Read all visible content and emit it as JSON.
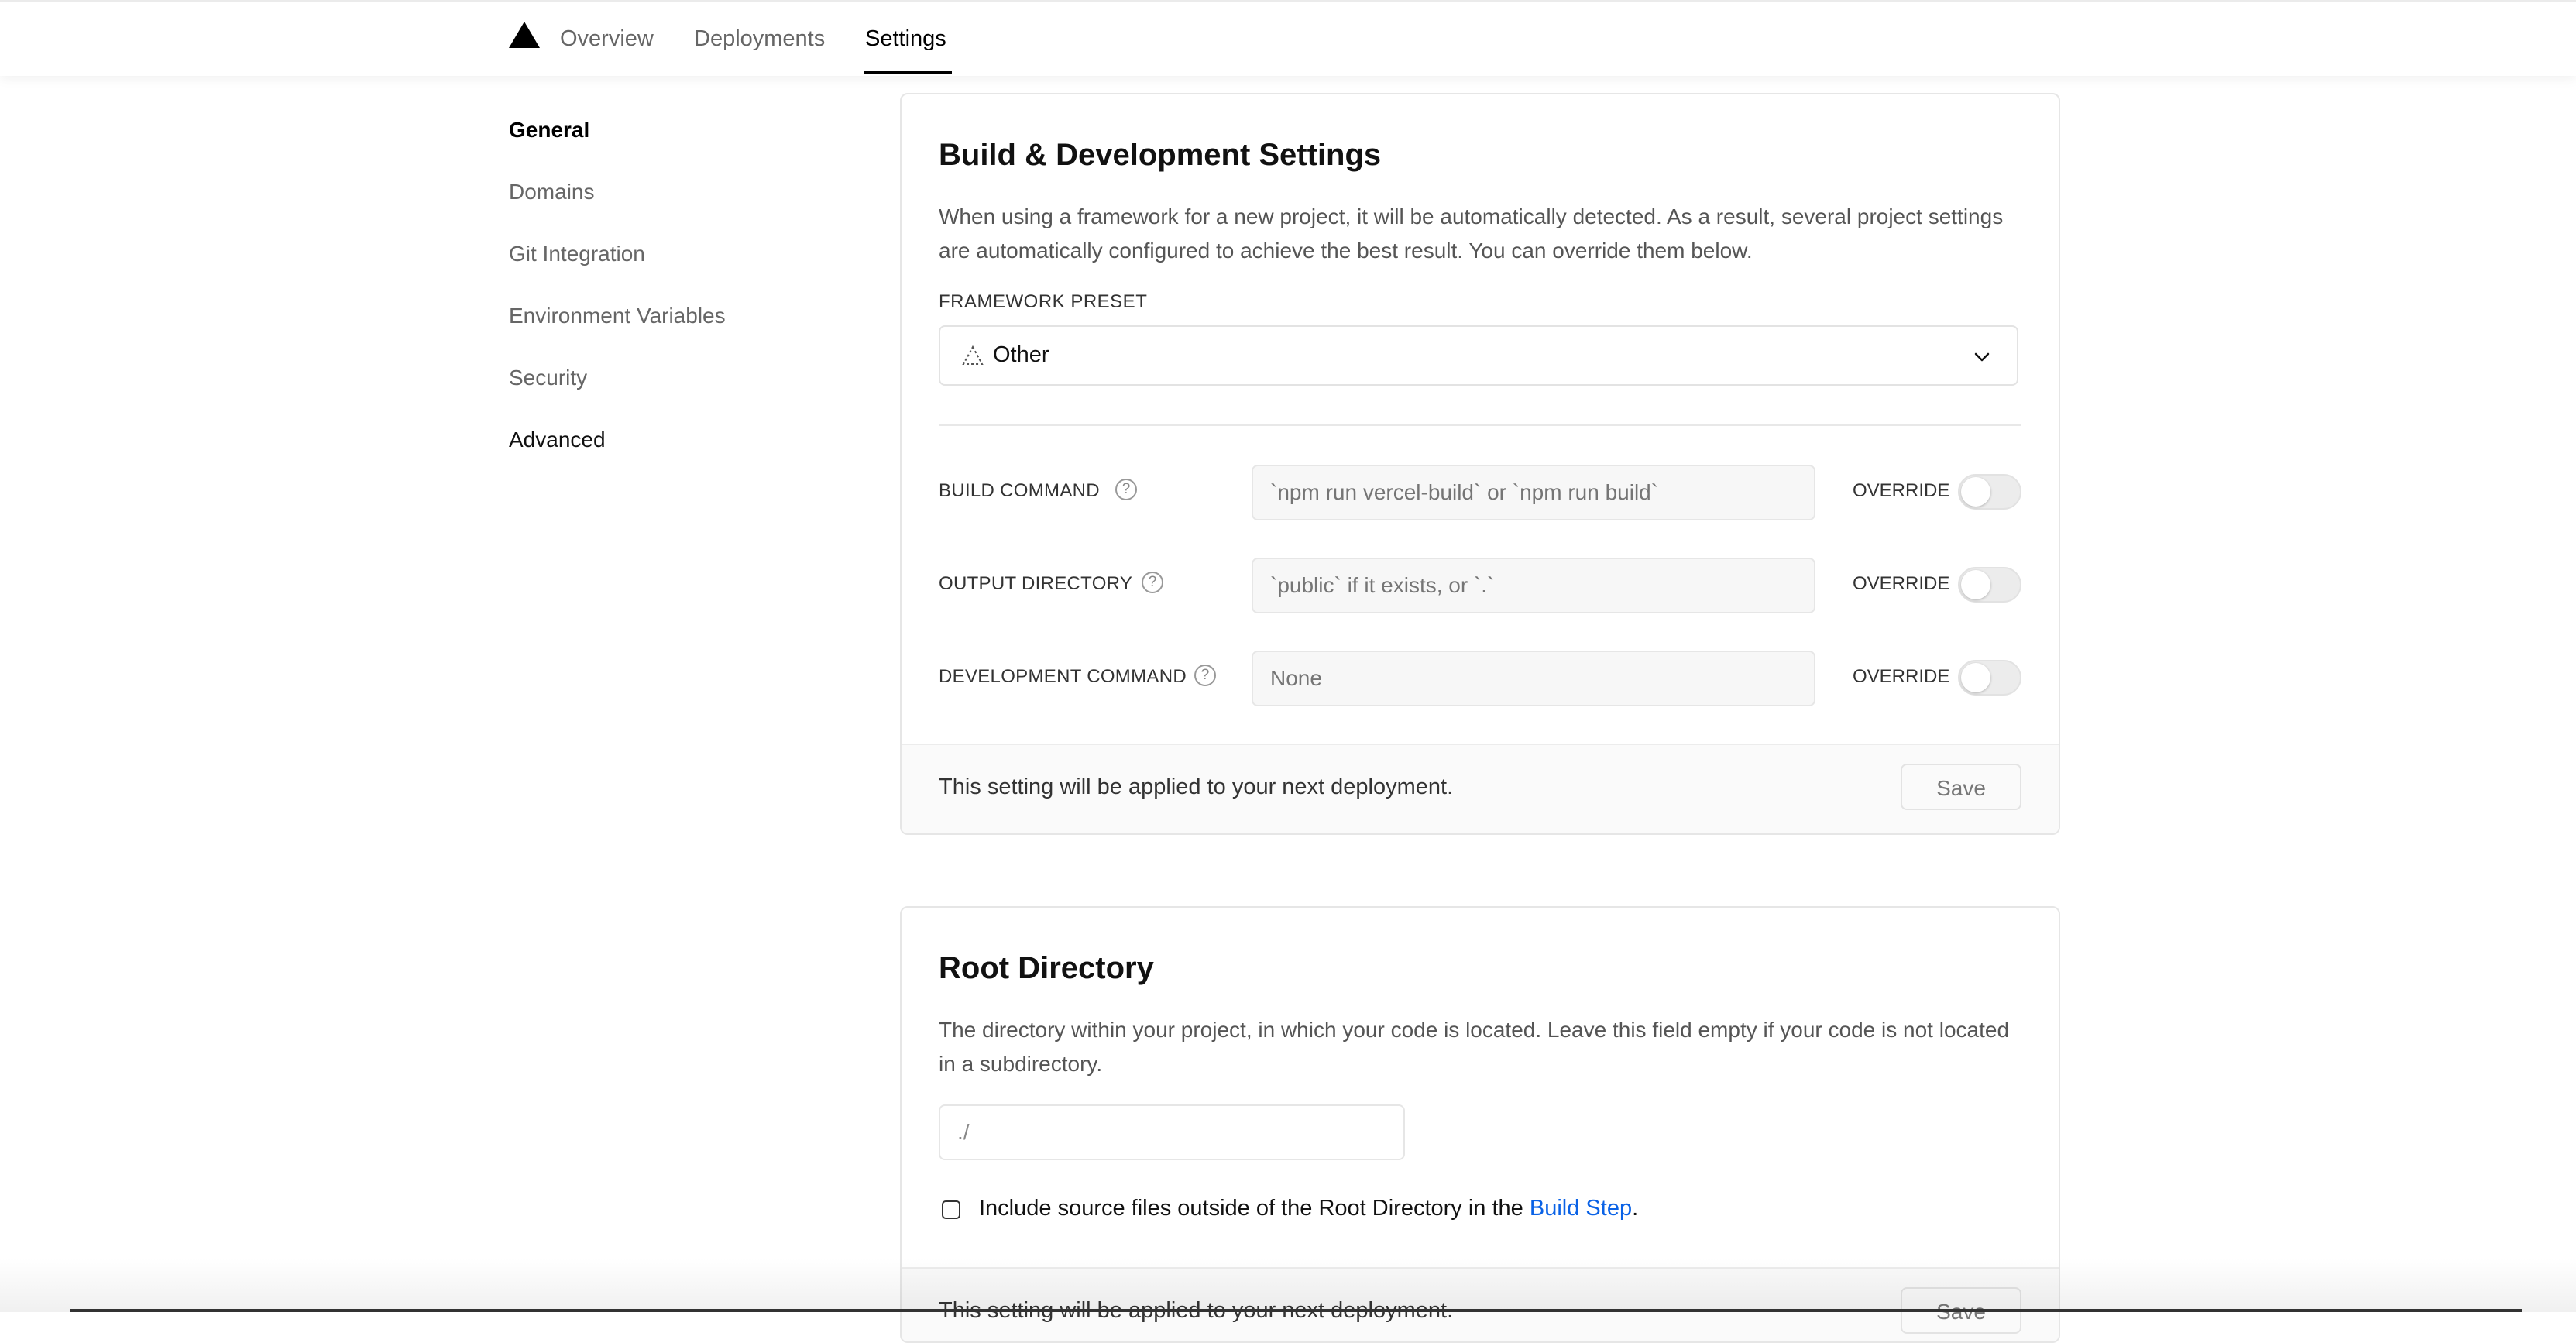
{
  "nav": {
    "tabs": [
      {
        "label": "Overview"
      },
      {
        "label": "Deployments"
      },
      {
        "label": "Settings",
        "active": true
      }
    ]
  },
  "sidebar": {
    "items": [
      {
        "label": "General"
      },
      {
        "label": "Domains"
      },
      {
        "label": "Git Integration"
      },
      {
        "label": "Environment Variables"
      },
      {
        "label": "Security"
      },
      {
        "label": "Advanced"
      }
    ]
  },
  "build_settings": {
    "title": "Build & Development Settings",
    "description": "When using a framework for a new project, it will be automatically detected. As a result, several project settings are automatically configured to achieve the best result. You can override them below.",
    "framework_label": "FRAMEWORK PRESET",
    "framework_value": "Other",
    "rows": [
      {
        "label": "BUILD COMMAND",
        "placeholder": "`npm run vercel-build` or `npm run build`",
        "override_label": "OVERRIDE",
        "override_on": false
      },
      {
        "label": "OUTPUT DIRECTORY",
        "placeholder": "`public` if it exists, or `.`",
        "override_label": "OVERRIDE",
        "override_on": false
      },
      {
        "label": "DEVELOPMENT COMMAND",
        "placeholder": "None",
        "override_label": "OVERRIDE",
        "override_on": false
      }
    ],
    "footer_text": "This setting will be applied to your next deployment.",
    "save_label": "Save"
  },
  "root_directory": {
    "title": "Root Directory",
    "description": "The directory within your project, in which your code is located. Leave this field empty if your code is not located in a subdirectory.",
    "input_value": "./",
    "checkbox_text": "Include source files outside of the Root Directory in the ",
    "checkbox_link": "Build Step",
    "checkbox_suffix": ".",
    "checkbox_checked": false,
    "footer_text": "This setting will be applied to your next deployment.",
    "save_label": "Save"
  },
  "colors": {
    "link": "#0a62e6",
    "active_tab": "#000000"
  }
}
